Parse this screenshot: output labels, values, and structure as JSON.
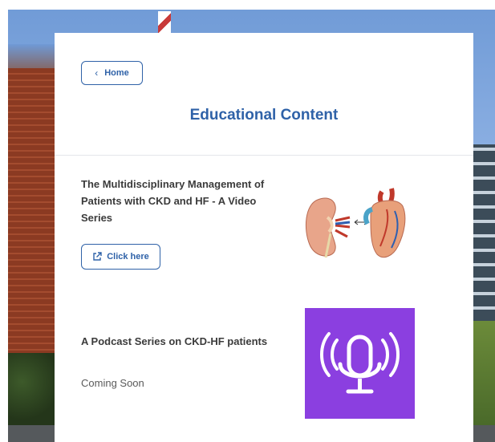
{
  "nav": {
    "home_label": "Home"
  },
  "page": {
    "title": "Educational Content"
  },
  "video_series": {
    "title": "The Multidisciplinary Management of Patients with CKD and HF - A Video Series",
    "button_label": "Click here"
  },
  "podcast": {
    "title": "A Podcast Series on CKD-HF patients",
    "status": "Coming Soon"
  },
  "colors": {
    "accent": "#2f62a8",
    "podcast_bg": "#8b3fe0",
    "card_bg": "#ffffff"
  },
  "icons": {
    "home_button": "chevron-left-icon",
    "click_button": "external-link-icon",
    "video_image": "kidney-heart-illustration",
    "podcast_image": "microphone-icon"
  }
}
